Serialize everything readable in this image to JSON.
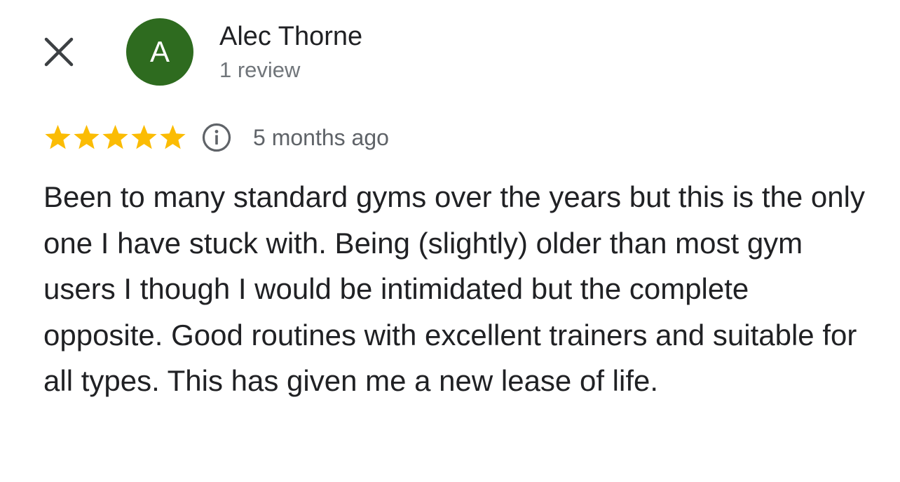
{
  "close": {
    "icon": "close-icon"
  },
  "author": {
    "avatar_letter": "A",
    "avatar_color": "#2e6b1f",
    "name": "Alec Thorne",
    "review_count": "1 review"
  },
  "rating": {
    "stars": 5,
    "max_stars": 5,
    "star_color": "#fbbc04",
    "info_icon": "info-icon",
    "time_ago": "5 months ago"
  },
  "review": {
    "text": "Been to many standard gyms over the years but this is the only one I have stuck with. Being (slightly) older than most gym users I though I would be intimidated but the complete opposite. Good routines with excellent trainers and suitable for all types. This has given me a new lease of life."
  }
}
